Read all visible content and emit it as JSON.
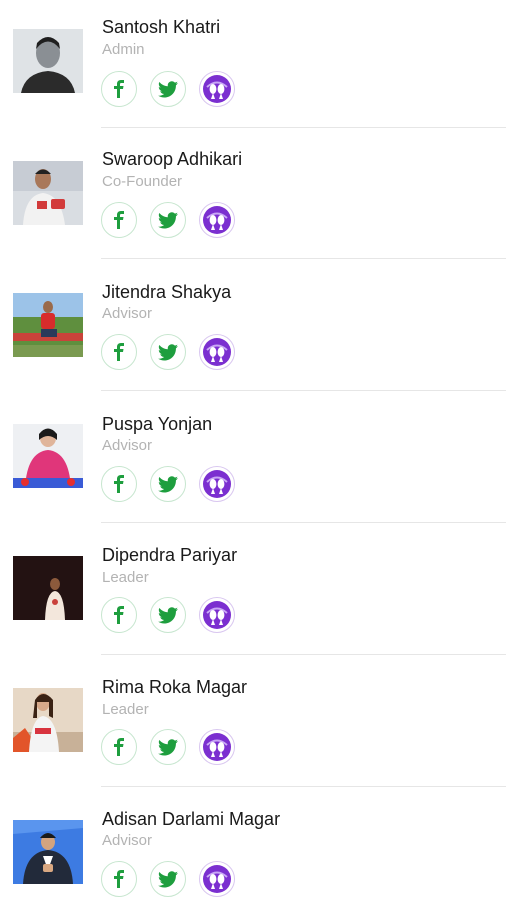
{
  "colors": {
    "social_green": "#1e9e3e",
    "app_purple": "#7b2fd0",
    "divider": "#e6e6e6",
    "role_text": "#b3b3b3"
  },
  "icons": {
    "facebook": "facebook-icon",
    "twitter": "twitter-icon",
    "app": "app-logo-icon"
  },
  "members": [
    {
      "name": "Santosh Khatri",
      "role": "Admin"
    },
    {
      "name": "Swaroop Adhikari",
      "role": "Co-Founder"
    },
    {
      "name": "Jitendra Shakya",
      "role": "Advisor"
    },
    {
      "name": "Puspa Yonjan",
      "role": "Advisor"
    },
    {
      "name": "Dipendra Pariyar",
      "role": "Leader"
    },
    {
      "name": "Rima Roka Magar",
      "role": "Leader"
    },
    {
      "name": "Adisan Darlami Magar",
      "role": "Advisor"
    }
  ]
}
